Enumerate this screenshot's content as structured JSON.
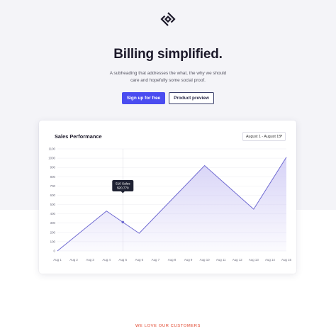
{
  "hero": {
    "logo_icon": "stacked-chevron-logo",
    "headline": "Billing simplified.",
    "subheading": "A subheading that addresses the what, the why we should care and hopefully some social proof.",
    "primary_cta": "Sign up for free",
    "secondary_cta": "Product preview"
  },
  "card": {
    "title": "Sales Performance",
    "date_range": "August 1 - August 15",
    "tooltip": {
      "line1": "510 Sales",
      "line2": "$20,770"
    }
  },
  "footer": {
    "eyebrow": "WE LOVE OUR CUSTOMERS"
  },
  "colors": {
    "accent": "#4a4cf0",
    "line": "#6f6ad1",
    "fill": "#cfcaf5",
    "eyebrow": "#e2452c"
  },
  "chart_data": {
    "type": "area",
    "title": "Sales Performance",
    "xlabel": "",
    "ylabel": "",
    "categories": [
      "Aug 1",
      "Aug 2",
      "Aug 3",
      "Aug 4",
      "Aug 5",
      "Aug 6",
      "Aug 7",
      "Aug 8",
      "Aug 9",
      "Aug 10",
      "Aug 11",
      "Aug 12",
      "Aug 13",
      "Aug 14",
      "Aug 15"
    ],
    "key_points": [
      {
        "x": "Aug 1",
        "y": 0
      },
      {
        "x": "Aug 4",
        "y": 430
      },
      {
        "x": "Aug 6",
        "y": 190
      },
      {
        "x": "Aug 10",
        "y": 920
      },
      {
        "x": "Aug 13",
        "y": 450
      },
      {
        "x": "Aug 15",
        "y": 1010
      }
    ],
    "highlight": {
      "x": "Aug 5",
      "label": "510 Sales",
      "value": "$20,770"
    },
    "yticks": [
      0,
      100,
      200,
      300,
      400,
      500,
      600,
      700,
      800,
      900,
      1000,
      1100
    ],
    "ylim": [
      0,
      1100
    ],
    "grid": true
  }
}
